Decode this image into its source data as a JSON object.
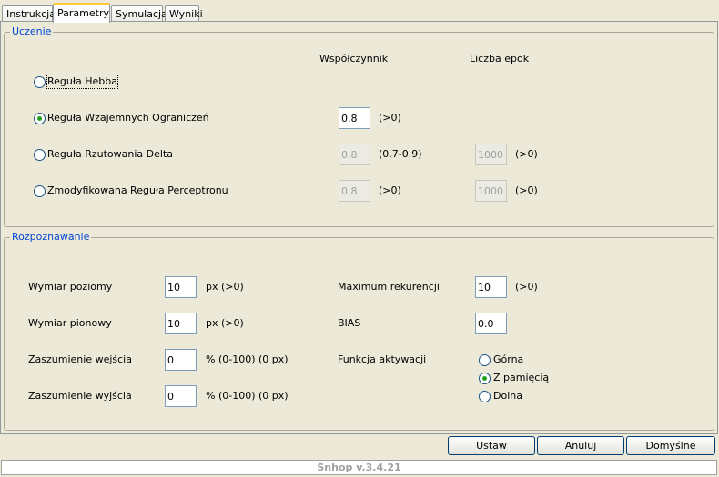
{
  "tabs": [
    {
      "label": "Instrukcja"
    },
    {
      "label": "Parametry"
    },
    {
      "label": "Symulacja"
    },
    {
      "label": "Wyniki"
    }
  ],
  "uczenie": {
    "legend": "Uczenie",
    "col_coefficient": "Współczynnik",
    "col_epochs": "Liczba epok",
    "rules": [
      {
        "label": "Reguła Hebba"
      },
      {
        "label": "Reguła Wzajemnych Ograniczeń",
        "coef": "0.8",
        "coef_hint": "(>0)"
      },
      {
        "label": "Reguła Rzutowania Delta",
        "coef": "0.8",
        "coef_hint": "(0.7-0.9)",
        "epochs": "1000",
        "epochs_hint": "(>0)"
      },
      {
        "label": "Zmodyfikowana Reguła Perceptronu",
        "coef": "0.8",
        "coef_hint": "(>0)",
        "epochs": "1000",
        "epochs_hint": "(>0)"
      }
    ],
    "selected_rule": 1
  },
  "rozpoznawanie": {
    "legend": "Rozpoznawanie",
    "left": [
      {
        "label": "Wymiar poziomy",
        "value": "10",
        "hint": "px (>0)"
      },
      {
        "label": "Wymiar pionowy",
        "value": "10",
        "hint": "px (>0)"
      },
      {
        "label": "Zaszumienie wejścia",
        "value": "0",
        "hint": "% (0-100) (0 px)"
      },
      {
        "label": "Zaszumienie wyjścia",
        "value": "0",
        "hint": "% (0-100) (0 px)"
      }
    ],
    "max_recurrence": {
      "label": "Maximum rekurencji",
      "value": "10",
      "hint": "(>0)"
    },
    "bias": {
      "label": "BIAS",
      "value": "0.0"
    },
    "activation": {
      "label": "Funkcja aktywacji",
      "options": [
        {
          "label": "Górna"
        },
        {
          "label": "Z pamięcią"
        },
        {
          "label": "Dolna"
        }
      ],
      "selected": 1
    }
  },
  "buttons": {
    "apply": "Ustaw",
    "cancel": "Anuluj",
    "defaults": "Domyślne"
  },
  "status": {
    "version": "Snhop v.3.4.21"
  }
}
